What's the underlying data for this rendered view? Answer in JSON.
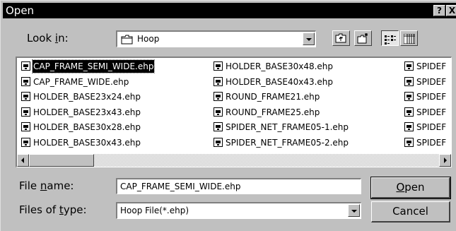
{
  "dialog": {
    "title": "Open",
    "help_label": "?",
    "close_label": "X"
  },
  "look_in": {
    "label_before": "Look ",
    "label_accel": "i",
    "label_after": "n:",
    "folder_icon": "folder-icon",
    "value": "Hoop"
  },
  "toolbar": {
    "up_icon": "up-one-level-icon",
    "new_folder_icon": "new-folder-icon",
    "list_icon": "list-view-icon",
    "details_icon": "details-view-icon",
    "list_view_active": true
  },
  "files": [
    "CAP_FRAME_SEMI_WIDE.ehp",
    "CAP_FRAME_WIDE.ehp",
    "HOLDER_BASE23x24.ehp",
    "HOLDER_BASE23x43.ehp",
    "HOLDER_BASE30x28.ehp",
    "HOLDER_BASE30x43.ehp",
    "HOLDER_BASE30x48.ehp",
    "HOLDER_BASE40x43.ehp",
    "ROUND_FRAME21.ehp",
    "ROUND_FRAME25.ehp",
    "SPIDER_NET_FRAME05-1.ehp",
    "SPIDER_NET_FRAME05-2.ehp",
    "SPIDEF",
    "SPIDEF",
    "SPIDEF",
    "SPIDEF",
    "SPIDEF",
    "SPIDEF"
  ],
  "selected_file_index": 0,
  "file_name": {
    "label_before": "File ",
    "label_accel": "n",
    "label_after": "ame:",
    "value": "CAP_FRAME_SEMI_WIDE.ehp"
  },
  "file_type": {
    "label_before": "Files of ",
    "label_accel": "t",
    "label_after": "ype:",
    "value": "Hoop File(*.ehp)"
  },
  "buttons": {
    "open_accel": "O",
    "open_rest": "pen",
    "cancel": "Cancel"
  },
  "colors": {
    "face": "#c0c0c0",
    "title_bar": "#000000",
    "selection": "#000000"
  }
}
